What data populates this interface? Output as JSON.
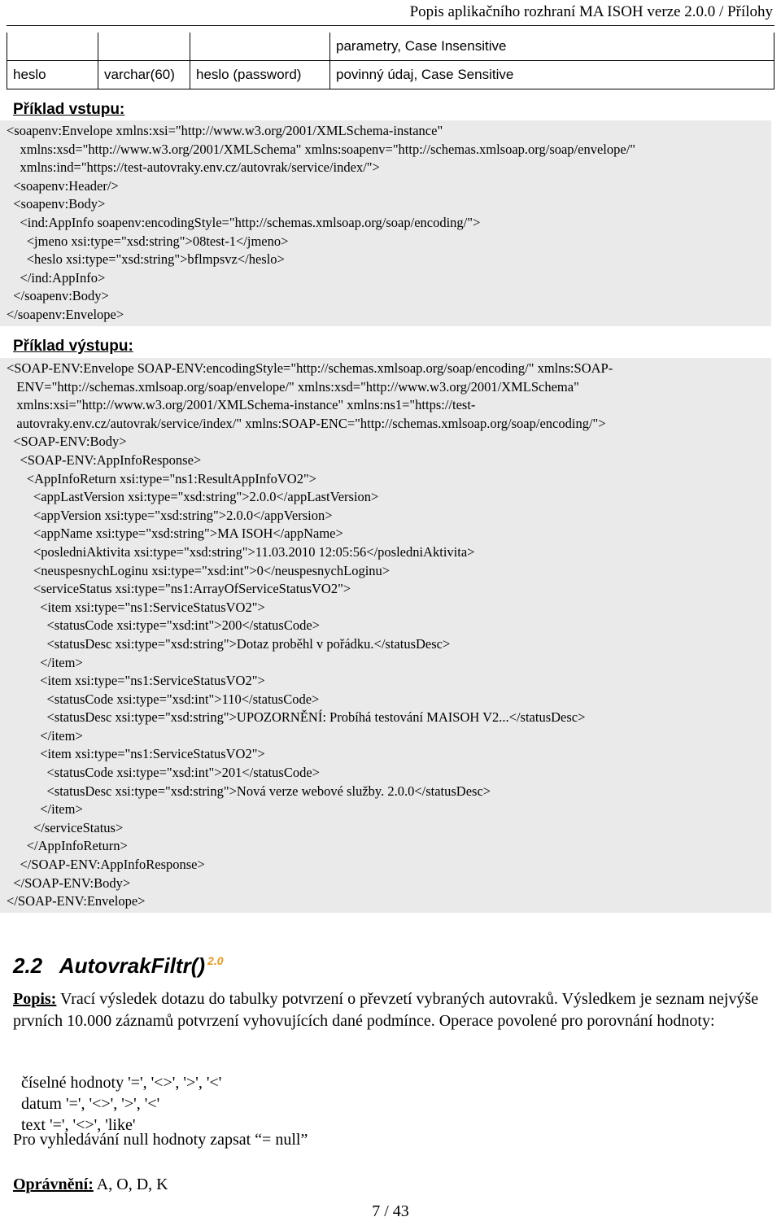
{
  "header": {
    "title": "Popis aplikačního rozhraní MA ISOH verze 2.0.0 / Přílohy"
  },
  "param_table": {
    "rows": [
      {
        "name": "",
        "type": "",
        "desc": "",
        "note": "parametry, Case Insensitive"
      },
      {
        "name": "heslo",
        "type": "varchar(60)",
        "desc": "heslo (password)",
        "note": "povinný údaj, Case Sensitive"
      }
    ]
  },
  "input_example": {
    "label": "Příklad vstupu:",
    "lines": [
      "<soapenv:Envelope xmlns:xsi=\"http://www.w3.org/2001/XMLSchema-instance\"",
      "    xmlns:xsd=\"http://www.w3.org/2001/XMLSchema\" xmlns:soapenv=\"http://schemas.xmlsoap.org/soap/envelope/\"",
      "    xmlns:ind=\"https://test-autovraky.env.cz/autovrak/service/index/\">",
      "  <soapenv:Header/>",
      "  <soapenv:Body>",
      "    <ind:AppInfo soapenv:encodingStyle=\"http://schemas.xmlsoap.org/soap/encoding/\">",
      "      <jmeno xsi:type=\"xsd:string\">08test-1</jmeno>",
      "      <heslo xsi:type=\"xsd:string\">bflmpsvz</heslo>",
      "    </ind:AppInfo>",
      "  </soapenv:Body>",
      "</soapenv:Envelope>"
    ]
  },
  "output_example": {
    "label": "Příklad výstupu:",
    "lines": [
      "<SOAP-ENV:Envelope SOAP-ENV:encodingStyle=\"http://schemas.xmlsoap.org/soap/encoding/\" xmlns:SOAP-",
      "   ENV=\"http://schemas.xmlsoap.org/soap/envelope/\" xmlns:xsd=\"http://www.w3.org/2001/XMLSchema\"",
      "   xmlns:xsi=\"http://www.w3.org/2001/XMLSchema-instance\" xmlns:ns1=\"https://test-",
      "   autovraky.env.cz/autovrak/service/index/\" xmlns:SOAP-ENC=\"http://schemas.xmlsoap.org/soap/encoding/\">",
      "  <SOAP-ENV:Body>",
      "    <SOAP-ENV:AppInfoResponse>",
      "      <AppInfoReturn xsi:type=\"ns1:ResultAppInfoVO2\">",
      "        <appLastVersion xsi:type=\"xsd:string\">2.0.0</appLastVersion>",
      "        <appVersion xsi:type=\"xsd:string\">2.0.0</appVersion>",
      "        <appName xsi:type=\"xsd:string\">MA ISOH</appName>",
      "        <posledniAktivita xsi:type=\"xsd:string\">11.03.2010 12:05:56</posledniAktivita>",
      "        <neuspesnychLoginu xsi:type=\"xsd:int\">0</neuspesnychLoginu>",
      "        <serviceStatus xsi:type=\"ns1:ArrayOfServiceStatusVO2\">",
      "          <item xsi:type=\"ns1:ServiceStatusVO2\">",
      "            <statusCode xsi:type=\"xsd:int\">200</statusCode>",
      "            <statusDesc xsi:type=\"xsd:string\">Dotaz proběhl v pořádku.</statusDesc>",
      "          </item>",
      "          <item xsi:type=\"ns1:ServiceStatusVO2\">",
      "            <statusCode xsi:type=\"xsd:int\">110</statusCode>",
      "            <statusDesc xsi:type=\"xsd:string\">UPOZORNĚNÍ: Probíhá testování MAISOH V2...</statusDesc>",
      "          </item>",
      "          <item xsi:type=\"ns1:ServiceStatusVO2\">",
      "            <statusCode xsi:type=\"xsd:int\">201</statusCode>",
      "            <statusDesc xsi:type=\"xsd:string\">Nová verze webové služby. 2.0.0</statusDesc>",
      "          </item>",
      "        </serviceStatus>",
      "      </AppInfoReturn>",
      "    </SOAP-ENV:AppInfoResponse>",
      "  </SOAP-ENV:Body>",
      "</SOAP-ENV:Envelope>"
    ]
  },
  "section": {
    "number": "2.2",
    "title": "AutovrakFiltr()",
    "version_badge": "2.0",
    "version_badge_color": "#e8971e"
  },
  "description": {
    "lead": "Popis:",
    "text": " Vrací výsledek dotazu do tabulky potvrzení o převzetí vybraných autovraků. Výsledkem je seznam nejvýše prvních 10.000 záznamů potvrzení vyhovujících dané podmínce. Operace povolené pro porovnání hodnoty:"
  },
  "operations": {
    "lines": [
      "číselné hodnoty '=', '<>', '>', '<'",
      "datum '=', '<>', '>', '<'",
      "text '=', '<>', 'like'"
    ]
  },
  "null_note": {
    "text": "Pro vyhledávání null hodnoty zapsat “= null”"
  },
  "permissions": {
    "lead": "Oprávnění:",
    "values": " A, O, D, K"
  },
  "footer": {
    "page": "7 / 43"
  }
}
